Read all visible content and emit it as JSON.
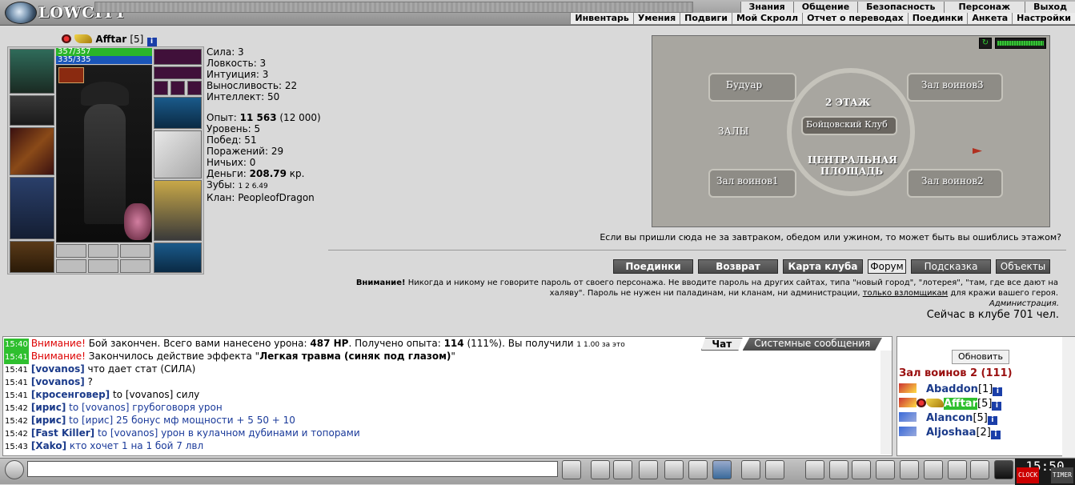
{
  "app": {
    "logo_text": "LOWCITY"
  },
  "nav": {
    "top": [
      "Знания",
      "Общение",
      "Безопасность",
      "Персонаж",
      "Выход"
    ],
    "sub": [
      "Инвентарь",
      "Умения",
      "Подвиги",
      "Мой Скролл",
      "Отчет о переводах",
      "Поединки",
      "Анкета",
      "Настройки"
    ]
  },
  "character": {
    "name": "Afftar",
    "level": "[5]",
    "hp": "357/357",
    "mp": "335/335"
  },
  "stats": {
    "strength": "Сила: 3",
    "agility": "Ловкость: 3",
    "intuition": "Интуиция: 3",
    "endurance": "Выносливость: 22",
    "intellect": "Интеллект: 50",
    "exp_label": "Опыт: ",
    "exp_value": "11 563",
    "exp_next": " (12 000)",
    "level": "Уровень: 5",
    "wins": "Побед: 51",
    "losses": "Поражений: 29",
    "draws": "Ничьих: 0",
    "money_label": "Деньги: ",
    "money_value": "208.79",
    "money_unit": " кр.",
    "teeth_label": "Зубы: ",
    "teeth_values": "1  2  6.49",
    "clan": "Клан: PeopleofDragon"
  },
  "map": {
    "rooms": [
      "Будуар",
      "Зал воинов3",
      "2 ЭТАЖ",
      "Бойцовский Клуб",
      "ЗАЛЫ",
      "ЦЕНТРАЛЬНАЯ ПЛОЩАДЬ",
      "Зал воинов1",
      "Зал воинов2"
    ],
    "note": "Если вы пришли сюда не за завтраком, обедом или ужином, то может быть вы ошиблись этажом?"
  },
  "actions": [
    "Поединки",
    "Возврат",
    "Карта клуба",
    "Форум",
    "Подсказка",
    "Объекты"
  ],
  "warning": {
    "title": "Внимание!",
    "text1": " Никогда и никому не говорите пароль от своего персонажа. Не вводите пароль на других сайтах, типа \"новый город\", \"лотерея\", \"там, где все дают на халяву\". Пароль не нужен ни паладинам, ни кланам, ни администрации, ",
    "link": "только взломщикам",
    "text2": " для кражи вашего героя.",
    "signature": "Администрация.",
    "online": "Сейчас в клубе 701 чел."
  },
  "chat": {
    "tabs": [
      "Чат",
      "Системные сообщения"
    ],
    "lines": [
      {
        "time": "15:40",
        "hl": true,
        "sys": "Внимание!",
        "text": " Бой закончен. Всего вами нанесено урона: ",
        "b1": "487 HP",
        "text2": ". Получено опыта: ",
        "b2": "114",
        "text3": " (111%). Вы получили ",
        "text4": "1  1.00 за это"
      },
      {
        "time": "15:41",
        "hl": true,
        "sys": "Внимание!",
        "text": " Закончилось действие эффекта \"",
        "b1": "Легкая травма (синяк под глазом)",
        "text2": "\""
      },
      {
        "time": "15:41",
        "nick": "[vovanos]",
        "msg": " что дает стат (СИЛА)"
      },
      {
        "time": "15:41",
        "nick": "[vovanos]",
        "msg": " ?"
      },
      {
        "time": "15:41",
        "nick": "[кросенговер]",
        "msg": " to [vovanos] силу"
      },
      {
        "time": "15:42",
        "nick": "[ирис]",
        "priv": " to [vovanos] грубоговоря урон"
      },
      {
        "time": "15:42",
        "nick": "[ирис]",
        "priv": " to [ирис] 25 бонус мф мощности + 5 50 + 10"
      },
      {
        "time": "15:42",
        "nick": "[Fast Killer]",
        "priv": " to [vovanos] урон в кулачном дубинами и топорами"
      },
      {
        "time": "15:43",
        "nick": "[Xako]",
        "priv": " кто хочет 1 на 1 бой 7 лвл"
      }
    ]
  },
  "users": {
    "refresh": "Обновить",
    "room": "Зал воинов 2 (111)",
    "list": [
      {
        "name": "Abaddon",
        "lvl": "[1]"
      },
      {
        "name": "Afftar",
        "lvl": "[5]"
      },
      {
        "name": "Alancon",
        "lvl": "[5]"
      },
      {
        "name": "Aljoshaa",
        "lvl": "[2]"
      }
    ]
  },
  "clock": {
    "time": "15:50",
    "left": "CLOCK",
    "right": "TIMER"
  }
}
